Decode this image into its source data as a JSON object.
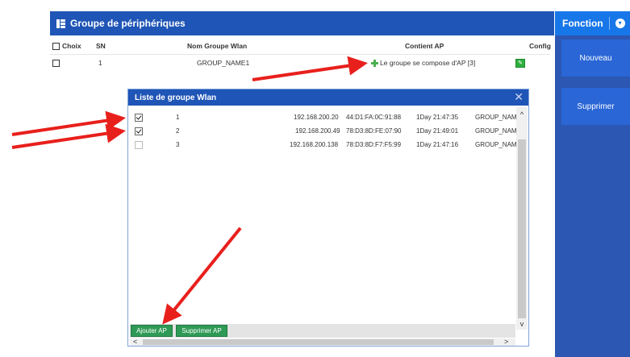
{
  "panel": {
    "title": "Groupe de périphériques"
  },
  "table": {
    "headers": {
      "choice": "Choix",
      "sn": "SN",
      "name": "Nom Groupe Wlan",
      "contains": "Contient AP",
      "config": "Config"
    },
    "rows": [
      {
        "sn": "1",
        "name": "GROUP_NAME1",
        "contains": "Le groupe se compose d'AP [3]"
      }
    ]
  },
  "sidebar": {
    "title": "Fonction",
    "buttons": {
      "new": "Nouveau",
      "delete": "Supprimer"
    }
  },
  "dialog": {
    "title": "Liste de groupe Wlan",
    "rows": [
      {
        "checked": true,
        "num": "1",
        "ip": "192.168.200.20",
        "mac": "44:D1:FA:0C:91:88",
        "uptime": "1Day 21:47:35",
        "group": "GROUP_NAMI"
      },
      {
        "checked": true,
        "num": "2",
        "ip": "192.168.200.49",
        "mac": "78:D3:8D:FE:07:90",
        "uptime": "1Day 21:49:01",
        "group": "GROUP_NAMI"
      },
      {
        "checked": false,
        "num": "3",
        "ip": "192.168.200.138",
        "mac": "78:D3:8D:F7:F5:99",
        "uptime": "1Day 21:47:16",
        "group": "GROUP_NAMI"
      }
    ],
    "buttons": {
      "add": "Ajouter AP",
      "remove": "Supprimer AP"
    }
  },
  "icons": {
    "grid": "grid-icon",
    "close": "close-icon",
    "chevron": "chevron-down-icon",
    "config": "edit-icon",
    "ap": "ap-group-icon"
  },
  "colors": {
    "header_blue": "#1f55b6",
    "sidebar_blue": "#2c57b2",
    "accent_blue": "#1877e8",
    "button_green": "#2f9a56",
    "arrow_red": "#e8201c"
  }
}
